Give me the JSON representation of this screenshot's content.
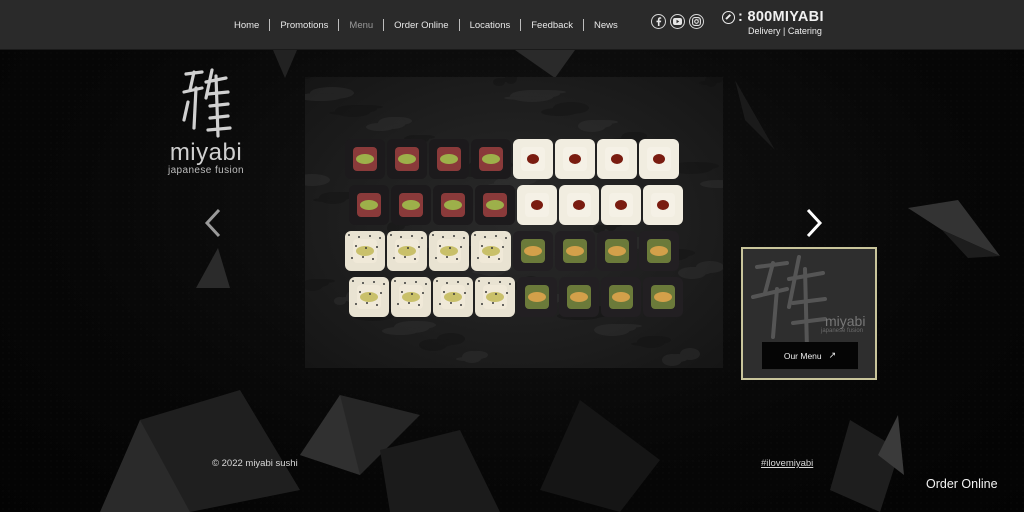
{
  "nav": {
    "items": [
      {
        "label": "Home"
      },
      {
        "label": "Promotions"
      },
      {
        "label": "Menu"
      },
      {
        "label": "Order Online"
      },
      {
        "label": "Locations"
      },
      {
        "label": "Feedback"
      },
      {
        "label": "News"
      }
    ],
    "active_index": 2
  },
  "social": [
    "facebook-icon",
    "youtube-icon",
    "instagram-icon"
  ],
  "contact": {
    "phone": ": 800MIYABI",
    "sub": "Delivery | Catering"
  },
  "logo": {
    "name": "miyabi",
    "tagline": "japanese fusion"
  },
  "menu_card": {
    "logo_name": "miyabi",
    "logo_tag": "japanese fusion",
    "button_label": "Our Menu",
    "button_icon": "↗"
  },
  "footer": {
    "copyright": "© 2022 miyabi sushi",
    "hashtag": "#ilovemiyabi"
  },
  "floating_order": "Order Online",
  "colors": {
    "header_bg": "#2a2a2a",
    "page_bg": "#050505",
    "card_border": "#c9c59b"
  }
}
